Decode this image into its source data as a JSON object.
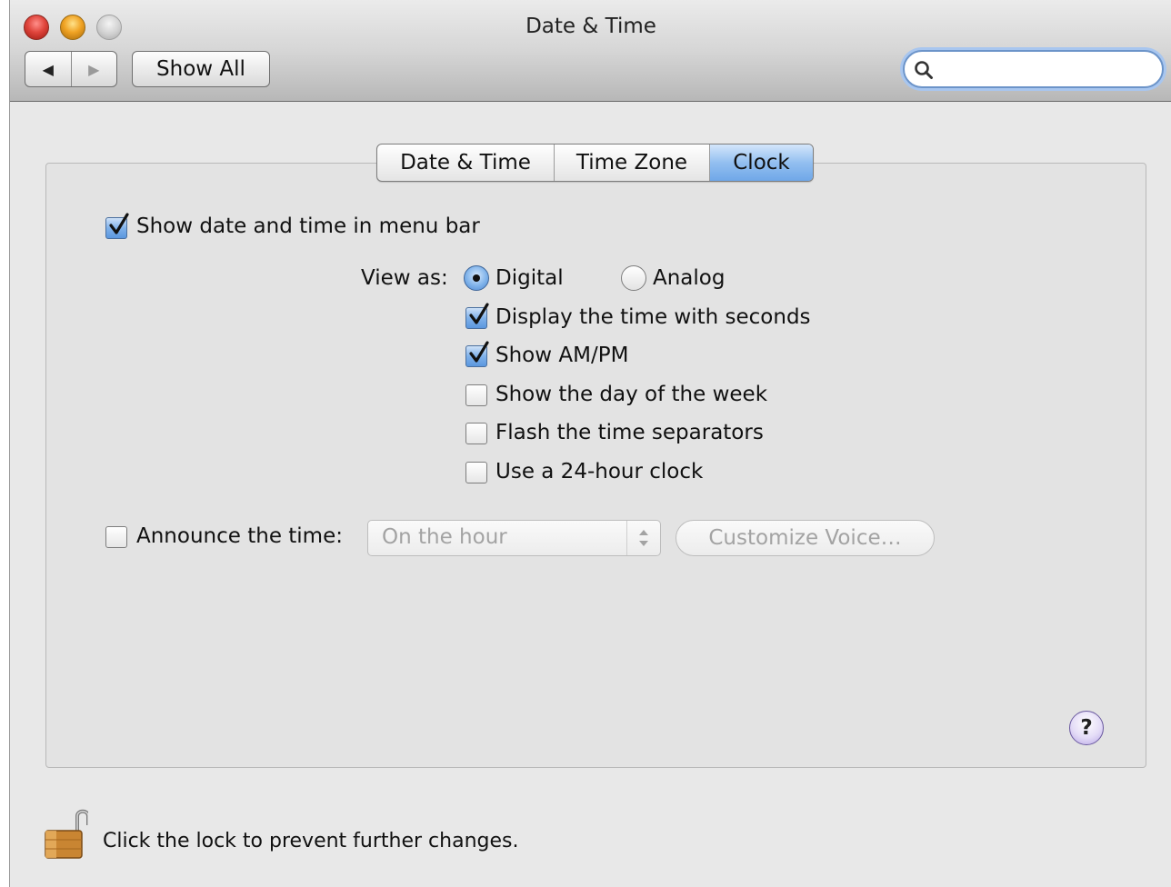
{
  "window": {
    "title": "Date & Time"
  },
  "toolbar": {
    "back_label": "◀",
    "forward_label": "▶",
    "show_all_label": "Show All",
    "search_placeholder": "",
    "search_value": ""
  },
  "tabs": [
    {
      "label": "Date & Time",
      "active": false
    },
    {
      "label": "Time Zone",
      "active": false
    },
    {
      "label": "Clock",
      "active": true
    }
  ],
  "clock": {
    "show_in_menu_bar": {
      "label": "Show date and time in menu bar",
      "checked": true
    },
    "view_as": {
      "label": "View as:",
      "options": [
        {
          "label": "Digital",
          "selected": true
        },
        {
          "label": "Analog",
          "selected": false
        }
      ]
    },
    "options": [
      {
        "label": "Display the time with seconds",
        "checked": true
      },
      {
        "label": "Show AM/PM",
        "checked": true
      },
      {
        "label": "Show the day of the week",
        "checked": false
      },
      {
        "label": "Flash the time separators",
        "checked": false
      },
      {
        "label": "Use a 24-hour clock",
        "checked": false
      }
    ],
    "announce": {
      "label": "Announce the time:",
      "checked": false,
      "frequency": "On the hour",
      "customize_label": "Customize Voice…"
    }
  },
  "help_label": "?",
  "lock_text": "Click the lock to prevent further changes.",
  "colors": {
    "accent": "#6fa7e8",
    "panel": "#e3e3e3",
    "disabled_text": "#a3a3a3"
  }
}
